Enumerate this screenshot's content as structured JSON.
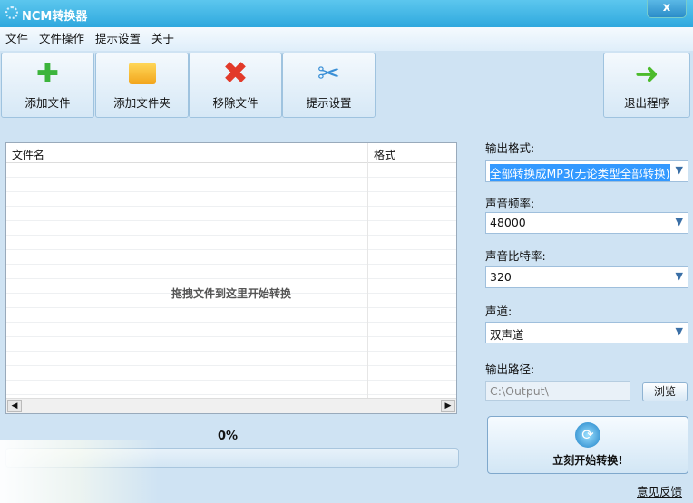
{
  "window": {
    "title": "NCM转换器",
    "close": "x"
  },
  "menu": [
    "文件",
    "文件操作",
    "提示设置",
    "关于"
  ],
  "toolbar": {
    "add_file": "添加文件",
    "add_folder": "添加文件夹",
    "remove_file": "移除文件",
    "prompt_settings": "提示设置",
    "exit": "退出程序"
  },
  "list": {
    "col_name": "文件名",
    "col_format": "格式",
    "drop_hint": "拖拽文件到这里开始转换"
  },
  "progress": {
    "text": "0%",
    "value": 0
  },
  "settings": {
    "format_label": "输出格式:",
    "format_value": "全部转换成MP3(无论类型全部转换)",
    "rate_label": "声音频率:",
    "rate_value": "48000",
    "bitrate_label": "声音比特率:",
    "bitrate_value": "320",
    "channel_label": "声道:",
    "channel_value": "双声道",
    "path_label": "输出路径:",
    "path_value": "C:\\Output\\",
    "browse": "浏览"
  },
  "convert_button": "立刻开始转换!",
  "feedback": "意见反馈"
}
